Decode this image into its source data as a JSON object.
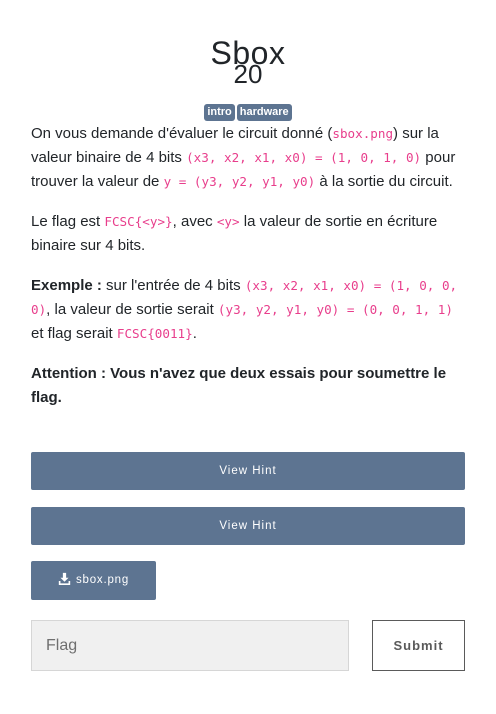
{
  "challenge": {
    "title": "Sbox",
    "points": "20",
    "tags": [
      "intro",
      "hardware"
    ]
  },
  "description": {
    "p1_a": "On vous demande d'évaluer le circuit donné (",
    "p1_code1": "sbox.png",
    "p1_b": ") sur la valeur binaire de 4 bits ",
    "p1_code2": "(x3, x2, x1, x0) = (1, 0, 1, 0)",
    "p1_c": " pour trouver la valeur de ",
    "p1_code3": "y = (y3, y2, y1, y0)",
    "p1_d": " à la sortie du circuit.",
    "p2_a": "Le flag est ",
    "p2_code1": "FCSC{<y>}",
    "p2_b": ", avec ",
    "p2_code2": "<y>",
    "p2_c": " la valeur de sortie en écriture binaire sur 4 bits.",
    "p3_label": "Exemple :",
    "p3_a": " sur l'entrée de 4 bits ",
    "p3_code1": "(x3, x2, x1, x0) = (1, 0, 0, 0)",
    "p3_b": ", la valeur de sortie serait ",
    "p3_code2": "(y3, y2, y1, y0) = (0, 0, 1, 1)",
    "p3_c": " et flag serait ",
    "p3_code3": "FCSC{0011}",
    "p3_d": ".",
    "p4_warning": "Attention : Vous n'avez que deux essais pour soumettre le flag."
  },
  "hints": [
    {
      "label": "View Hint"
    },
    {
      "label": "View Hint"
    }
  ],
  "file": {
    "name": "sbox.png",
    "icon": "download-icon"
  },
  "submission": {
    "placeholder": "Flag",
    "submit_label": "Submit"
  },
  "colors": {
    "button": "#5d7491",
    "code": "#e83e8c",
    "text": "#212529"
  }
}
